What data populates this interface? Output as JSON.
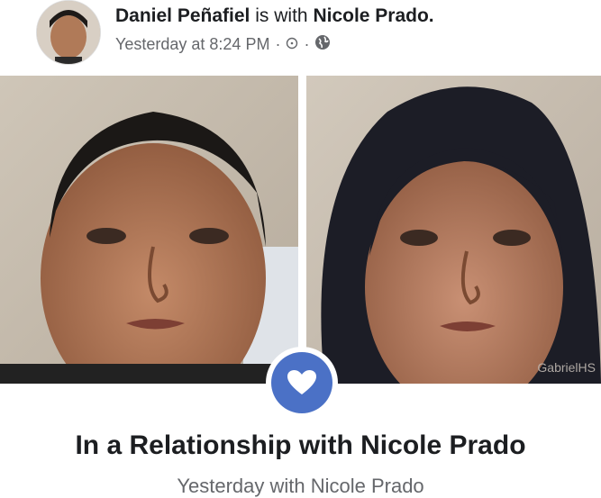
{
  "post": {
    "author": "Daniel Peñafiel",
    "with_text": "is with",
    "tagged": "Nicole Prado.",
    "timestamp": "Yesterday at 8:24 PM",
    "separator": "·",
    "icons": [
      "clock-dot-icon",
      "globe-icon"
    ]
  },
  "photos": {
    "watermark": "GabrielHS"
  },
  "life_event": {
    "icon": "heart-icon",
    "title": "In a Relationship with Nicole Prado",
    "subtitle": "Yesterday with Nicole Prado"
  },
  "colors": {
    "accent": "#4b71c6",
    "text": "#1c1e21",
    "meta": "#65676b"
  }
}
